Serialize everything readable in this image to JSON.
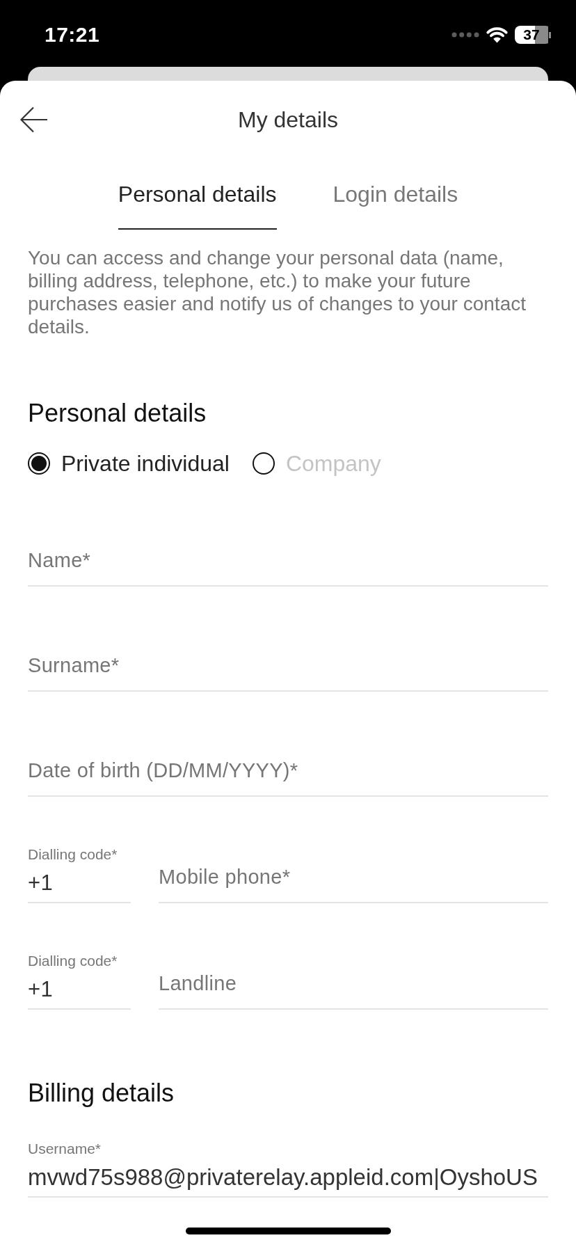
{
  "status_bar": {
    "time": "17:21",
    "battery": "37"
  },
  "header": {
    "title": "My details"
  },
  "tabs": [
    {
      "label": "Personal details",
      "selected": true
    },
    {
      "label": "Login details",
      "selected": false
    }
  ],
  "intro": "You can access and change your personal data (name, billing address, telephone, etc.) to make your future purchases easier and notify us of changes to your contact details.",
  "personal_details": {
    "heading": "Personal details",
    "customer_type": [
      {
        "label": "Private individual",
        "selected": true
      },
      {
        "label": "Company",
        "selected": false
      }
    ],
    "fields": [
      {
        "kind": "text",
        "placeholder": "Name*"
      },
      {
        "kind": "text",
        "placeholder": "Surname*"
      },
      {
        "kind": "text",
        "placeholder": "Date of birth (DD/MM/YYYY)*"
      },
      {
        "kind": "phone",
        "code_label": "Dialling code*",
        "code_value": "+1",
        "placeholder": "Mobile phone*"
      },
      {
        "kind": "phone",
        "code_label": "Dialling code*",
        "code_value": "+1",
        "placeholder": "Landline"
      }
    ]
  },
  "billing_details": {
    "heading": "Billing details",
    "fields": [
      {
        "kind": "labeled",
        "label": "Username*",
        "value": "mvwd75s988@privaterelay.appleid.com|OyshoUS"
      }
    ]
  }
}
